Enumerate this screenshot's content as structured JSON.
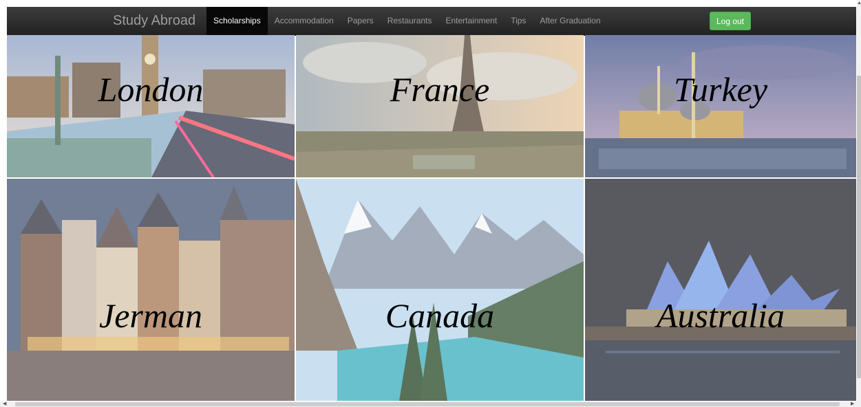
{
  "navbar": {
    "brand": "Study Abroad",
    "items": [
      {
        "label": "Scholarships",
        "active": true
      },
      {
        "label": "Accommodation"
      },
      {
        "label": "Papers"
      },
      {
        "label": "Restaurants"
      },
      {
        "label": "Entertainment"
      },
      {
        "label": "Tips"
      },
      {
        "label": "After Graduation"
      }
    ],
    "logout_label": "Log out"
  },
  "destinations": [
    {
      "label": "London",
      "image": "london-bridge-photo"
    },
    {
      "label": "France",
      "image": "eiffel-tower-photo"
    },
    {
      "label": "Turkey",
      "image": "istanbul-mosque-photo"
    },
    {
      "label": "Jerman",
      "image": "frankfurt-old-town-photo"
    },
    {
      "label": "Canada",
      "image": "moraine-lake-photo"
    },
    {
      "label": "Australia",
      "image": "sydney-opera-house-photo"
    }
  ],
  "colors": {
    "navbar": "#222222",
    "logout": "#5cb85c",
    "label": "#000000"
  }
}
